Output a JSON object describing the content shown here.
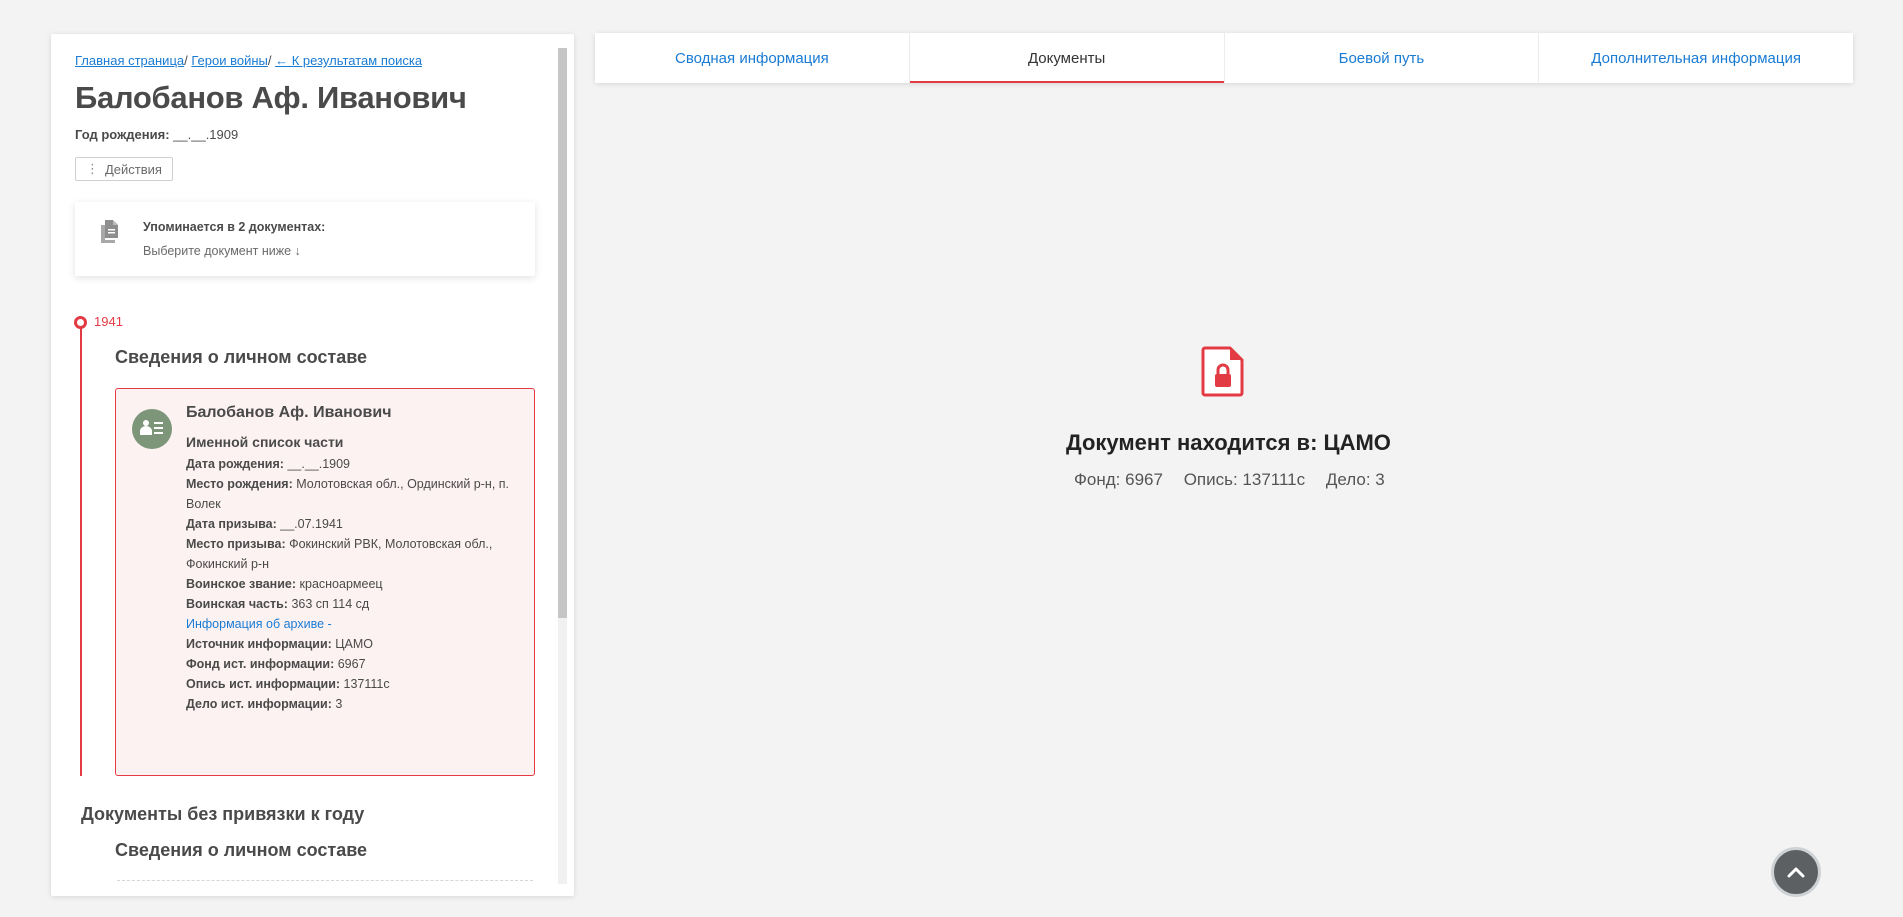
{
  "breadcrumb": {
    "home": "Главная страница",
    "heroes": "Герои войны",
    "back": "← К результатам поиска",
    "sep": "/"
  },
  "person": {
    "name": "Балобанов Аф. Иванович",
    "birth_label": "Год рождения:",
    "birth_value": "__.__.1909"
  },
  "actions": {
    "icon": "⋮",
    "label": "Действия"
  },
  "mention": {
    "title": "Упоминается в 2 документах:",
    "subtitle": "Выберите документ ниже ↓"
  },
  "timeline": {
    "year": "1941",
    "section_title": "Сведения о личном составе"
  },
  "record": {
    "name": "Балобанов Аф. Иванович",
    "type": "Именной список части",
    "fields": [
      {
        "label": "Дата рождения:",
        "value": "__.__.1909"
      },
      {
        "label": "Место рождения:",
        "value": "Молотовская обл., Ординский р-н, п. Волек"
      },
      {
        "label": "Дата призыва:",
        "value": "__.07.1941"
      },
      {
        "label": "Место призыва:",
        "value": "Фокинский РВК, Молотовская обл., Фокинский р-н"
      },
      {
        "label": "Воинское звание:",
        "value": "красноармеец"
      },
      {
        "label": "Воинская часть:",
        "value": "363 сп 114 сд"
      }
    ],
    "archive_link": "Информация об архиве -",
    "archive_fields": [
      {
        "label": "Источник информации:",
        "value": "ЦАМО"
      },
      {
        "label": "Фонд ист. информации:",
        "value": "6967"
      },
      {
        "label": "Опись ист. информации:",
        "value": "137111с"
      },
      {
        "label": "Дело ист. информации:",
        "value": "3"
      }
    ]
  },
  "no_year": {
    "title": "Документы без привязки к году",
    "section_title": "Сведения о личном составе"
  },
  "tabs": [
    {
      "label": "Сводная информация",
      "active": false
    },
    {
      "label": "Документы",
      "active": true
    },
    {
      "label": "Боевой путь",
      "active": false
    },
    {
      "label": "Дополнительная информация",
      "active": false
    }
  ],
  "document": {
    "title": "Документ находится в: ЦАМО",
    "fond": "Фонд: 6967",
    "opis": "Опись: 137111с",
    "delo": "Дело: 3"
  },
  "colors": {
    "accent": "#e33b43",
    "link": "#1a7bd3",
    "avatar": "#7d9579",
    "card_bg": "#fdf2f2"
  },
  "icons": {
    "documents": "documents-icon",
    "avatar": "person-list-icon",
    "locked_doc": "locked-document-icon",
    "scroll_top": "chevron-up-icon"
  }
}
